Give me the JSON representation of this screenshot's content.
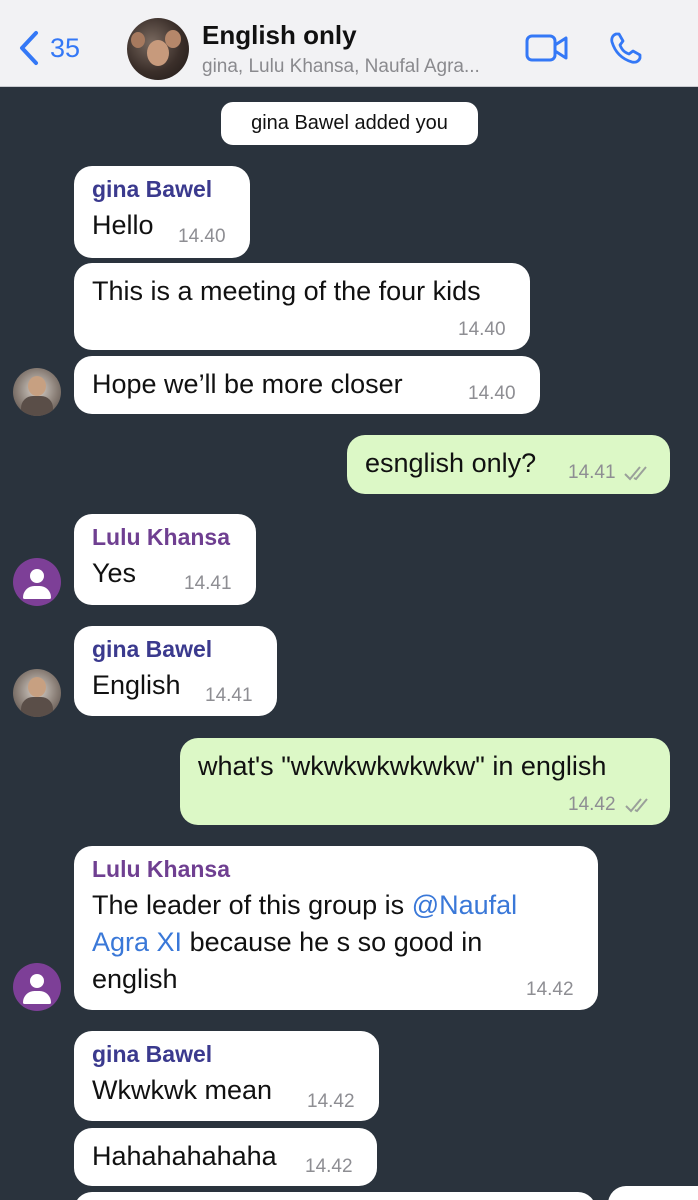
{
  "header": {
    "back_count": "35",
    "title": "English only",
    "subtitle": "gina, Lulu Khansa, Naufal Agra...",
    "avatar_icon": "group-photo"
  },
  "system_message": "gina Bawel added you",
  "messages": [
    {
      "sender": "gina Bawel",
      "text": "Hello",
      "time": "14.40",
      "direction": "incoming"
    },
    {
      "text": "This is a meeting of the four kids",
      "time": "14.40",
      "direction": "incoming"
    },
    {
      "text": "Hope we’ll be more closer",
      "time": "14.40",
      "direction": "incoming"
    },
    {
      "text": "esnglish only?",
      "time": "14.41",
      "direction": "outgoing",
      "status": "read"
    },
    {
      "sender": "Lulu Khansa",
      "text": "Yes",
      "time": "14.41",
      "direction": "incoming"
    },
    {
      "sender": "gina Bawel",
      "text": "English",
      "time": "14.41",
      "direction": "incoming"
    },
    {
      "text": "what's \"wkwkwkwkwkw\" in english",
      "time": "14.42",
      "direction": "outgoing",
      "status": "read"
    },
    {
      "sender": "Lulu Khansa",
      "text_before": "The leader of this group is",
      "mention_line1": "@Naufal",
      "mention_line2": "Agra XI",
      "text_after": "because he s so good in",
      "text_line3": "english",
      "time": "14.42",
      "direction": "incoming"
    },
    {
      "sender": "gina Bawel",
      "text": "Wkwkwk mean",
      "time": "14.42",
      "direction": "incoming"
    },
    {
      "text": "Hahahahahaha",
      "time": "14.42",
      "direction": "incoming"
    }
  ],
  "colors": {
    "chat_background": "#2a333d",
    "incoming_bubble": "#ffffff",
    "outgoing_bubble": "#dcf8c6",
    "accent": "#3478f6",
    "gina_name": "#3b3a8e",
    "lulu_name": "#6f3f91"
  }
}
